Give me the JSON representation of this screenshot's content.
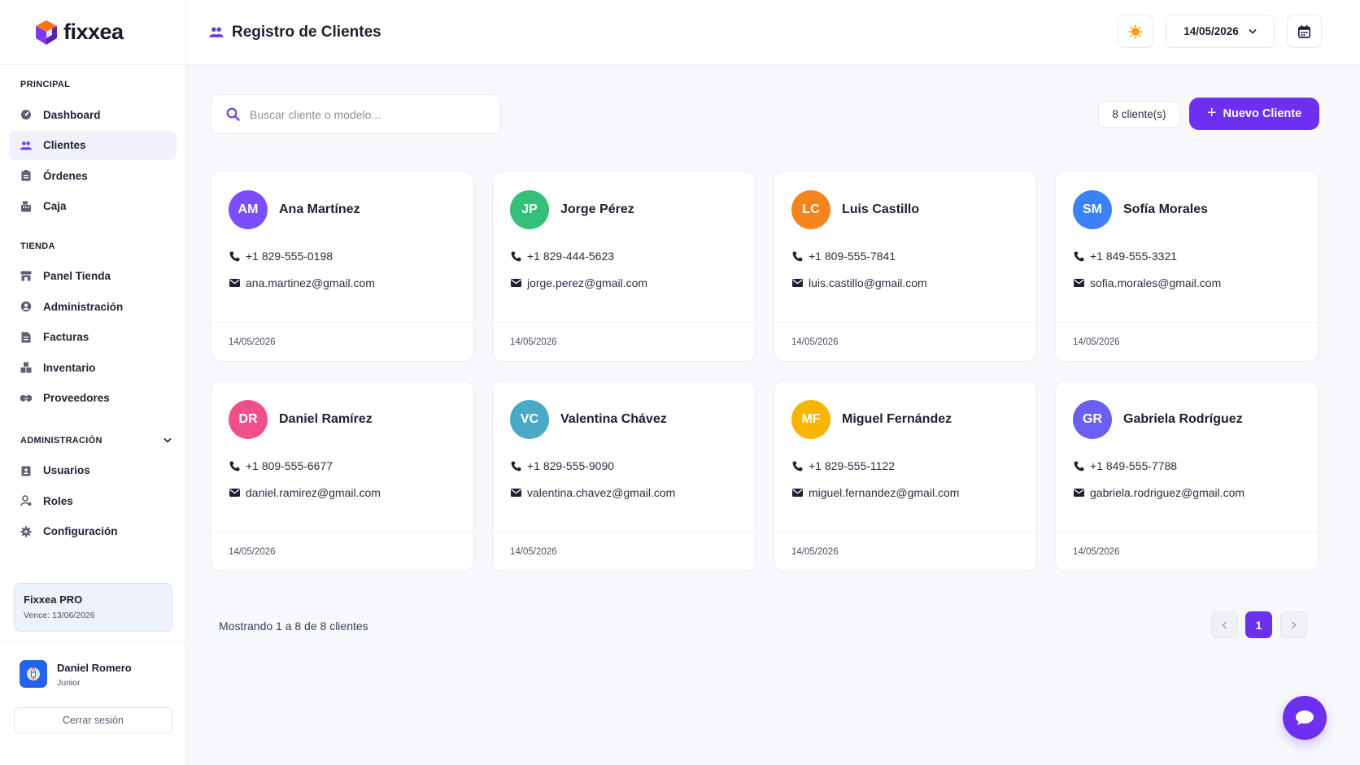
{
  "colors": {
    "accent": "#6d2ff0",
    "sidebar_active_bg": "#f0f1fb",
    "theme_icon": "#f59e0b"
  },
  "brand": {
    "name": "fixxea",
    "logo_icon": "cube-logo-icon"
  },
  "sidebar": {
    "sections": [
      {
        "heading": "PRINCIPAL",
        "items": [
          {
            "label": "Dashboard",
            "icon": "dashboard-icon",
            "active": false
          },
          {
            "label": "Clientes",
            "icon": "users-icon",
            "active": true
          },
          {
            "label": "Órdenes",
            "icon": "clipboard-icon",
            "active": false
          },
          {
            "label": "Caja",
            "icon": "cash-register-icon",
            "active": false
          }
        ]
      },
      {
        "heading": "TIENDA",
        "items": [
          {
            "label": "Panel Tienda",
            "icon": "store-icon",
            "active": false
          },
          {
            "label": "Administración",
            "icon": "admin-icon",
            "active": false
          },
          {
            "label": "Facturas",
            "icon": "invoice-icon",
            "active": false
          },
          {
            "label": "Inventario",
            "icon": "boxes-icon",
            "active": false
          },
          {
            "label": "Proveedores",
            "icon": "handshake-icon",
            "active": false
          }
        ]
      },
      {
        "heading": "ADMINISTRACIÓN",
        "collapsible": true,
        "items": [
          {
            "label": "Usuarios",
            "icon": "user-badge-icon",
            "active": false
          },
          {
            "label": "Roles",
            "icon": "roles-icon",
            "active": false
          },
          {
            "label": "Configuración",
            "icon": "gear-icon",
            "active": false
          }
        ]
      }
    ],
    "plan": {
      "title": "Fixxea PRO",
      "expiry": "Vence: 13/06/2026"
    },
    "user": {
      "name": "Daniel Romero",
      "role": "Junior"
    },
    "logout_label": "Cerrar sesión"
  },
  "header": {
    "title": "Registro de Clientes",
    "date": "14/05/2026",
    "theme_icon": "sun-icon",
    "calendar_icon": "calendar-icon"
  },
  "toolbar": {
    "search_placeholder": "Buscar cliente o modelo...",
    "search_value": "",
    "count_label": "8 cliente(s)",
    "new_button_label": "Nuevo Cliente"
  },
  "clients": [
    {
      "initials": "AM",
      "name": "Ana Martínez",
      "phone": "+1 829-555-0198",
      "email": "ana.martinez@gmail.com",
      "date": "14/05/2026",
      "color": "#7c4dff"
    },
    {
      "initials": "JP",
      "name": "Jorge Pérez",
      "phone": "+1 829-444-5623",
      "email": "jorge.perez@gmail.com",
      "date": "14/05/2026",
      "color": "#34c07a"
    },
    {
      "initials": "LC",
      "name": "Luis Castillo",
      "phone": "+1 809-555-7841",
      "email": "luis.castillo@gmail.com",
      "date": "14/05/2026",
      "color": "#f5841f"
    },
    {
      "initials": "SM",
      "name": "Sofía Morales",
      "phone": "+1 849-555-3321",
      "email": "sofia.morales@gmail.com",
      "date": "14/05/2026",
      "color": "#3b82f6"
    },
    {
      "initials": "DR",
      "name": "Daniel Ramírez",
      "phone": "+1 809-555-6677",
      "email": "daniel.ramirez@gmail.com",
      "date": "14/05/2026",
      "color": "#f0508a"
    },
    {
      "initials": "VC",
      "name": "Valentina Chávez",
      "phone": "+1 829-555-9090",
      "email": "valentina.chavez@gmail.com",
      "date": "14/05/2026",
      "color": "#4aa9c4"
    },
    {
      "initials": "MF",
      "name": "Miguel Fernández",
      "phone": "+1 829-555-1122",
      "email": "miguel.fernandez@gmail.com",
      "date": "14/05/2026",
      "color": "#f7b500"
    },
    {
      "initials": "GR",
      "name": "Gabriela Rodríguez",
      "phone": "+1 849-555-7788",
      "email": "gabriela.rodriguez@gmail.com",
      "date": "14/05/2026",
      "color": "#6a5ff0"
    }
  ],
  "pagination": {
    "summary": "Mostrando 1 a 8 de 8 clientes",
    "current_page": "1",
    "prev_icon": "chevron-left-icon",
    "next_icon": "chevron-right-icon"
  },
  "chat_button_icon": "chat-bubble-icon"
}
